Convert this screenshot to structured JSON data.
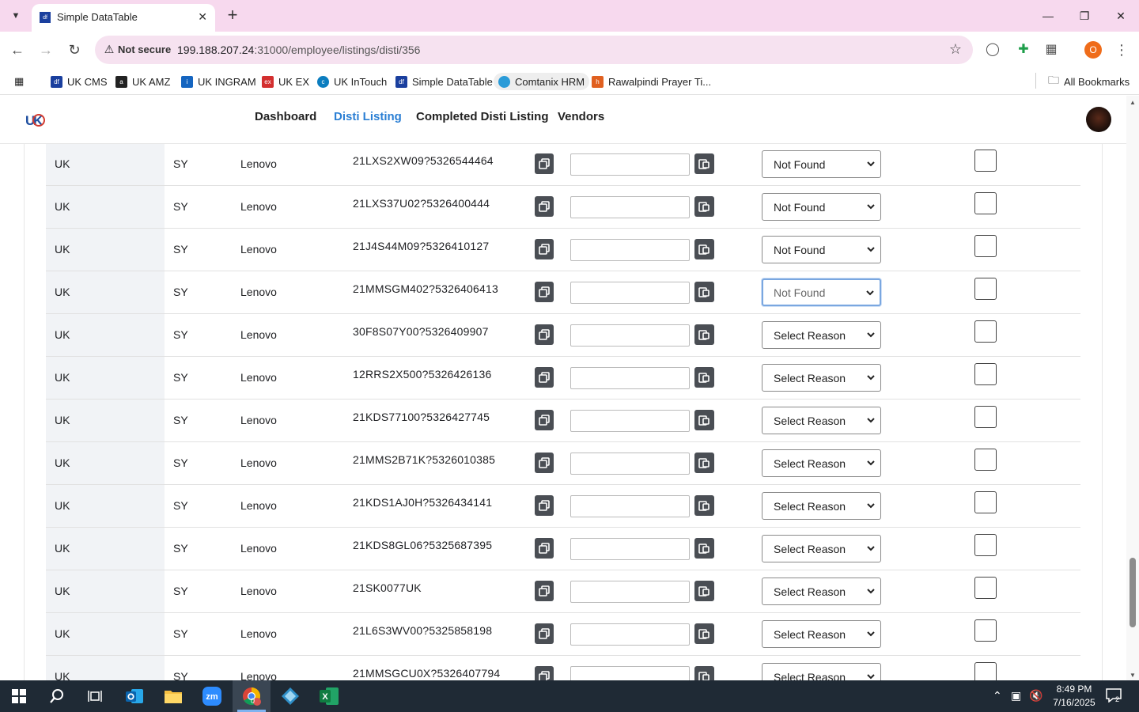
{
  "browser": {
    "tab_title": "Simple DataTable",
    "security_label": "Not secure",
    "url_host": "199.188.207.24",
    "url_rest": ":31000/employee/listings/disti/356",
    "profile_initial": "O",
    "bookmarks": [
      {
        "label": "UK CMS",
        "icon": "df-favicon",
        "color": "#1a3f9e"
      },
      {
        "label": "UK AMZ",
        "icon": "amazon-favicon",
        "color": "#222222"
      },
      {
        "label": "UK INGRAM",
        "icon": "ingram-favicon",
        "color": "#1565c0"
      },
      {
        "label": "UK EX",
        "icon": "ex-favicon",
        "color": "#d32f2f"
      },
      {
        "label": "UK InTouch",
        "icon": "intouch-favicon",
        "color": "#0b7dbf"
      },
      {
        "label": "Simple DataTable",
        "icon": "df-favicon",
        "color": "#1a3f9e"
      },
      {
        "label": "Comtanix HRM",
        "icon": "comtanix-favicon",
        "color": "#2a9bd8"
      },
      {
        "label": "Rawalpindi Prayer Ti...",
        "icon": "prayer-favicon",
        "color": "#e06020"
      }
    ],
    "all_bookmarks": "All Bookmarks"
  },
  "app": {
    "nav": [
      {
        "label": "Dashboard",
        "active": false
      },
      {
        "label": "Disti Listing",
        "active": true
      },
      {
        "label": "Completed Disti Listing",
        "active": false
      },
      {
        "label": "Vendors",
        "active": false
      }
    ]
  },
  "table": {
    "rows": [
      {
        "country": "UK",
        "source": "SY",
        "brand": "Lenovo",
        "sku": "21LXS2XW09?5326544464",
        "input": "",
        "reason": "Not Found",
        "focused": false,
        "checked": false
      },
      {
        "country": "UK",
        "source": "SY",
        "brand": "Lenovo",
        "sku": "21LXS37U02?5326400444",
        "input": "",
        "reason": "Not Found",
        "focused": false,
        "checked": false
      },
      {
        "country": "UK",
        "source": "SY",
        "brand": "Lenovo",
        "sku": "21J4S44M09?5326410127",
        "input": "",
        "reason": "Not Found",
        "focused": false,
        "checked": false
      },
      {
        "country": "UK",
        "source": "SY",
        "brand": "Lenovo",
        "sku": "21MMSGM402?5326406413",
        "input": "",
        "reason": "Not Found",
        "focused": true,
        "checked": false
      },
      {
        "country": "UK",
        "source": "SY",
        "brand": "Lenovo",
        "sku": "30F8S07Y00?5326409907",
        "input": "",
        "reason": "Select Reason",
        "focused": false,
        "checked": false
      },
      {
        "country": "UK",
        "source": "SY",
        "brand": "Lenovo",
        "sku": "12RRS2X500?5326426136",
        "input": "",
        "reason": "Select Reason",
        "focused": false,
        "checked": false
      },
      {
        "country": "UK",
        "source": "SY",
        "brand": "Lenovo",
        "sku": "21KDS77100?5326427745",
        "input": "",
        "reason": "Select Reason",
        "focused": false,
        "checked": false
      },
      {
        "country": "UK",
        "source": "SY",
        "brand": "Lenovo",
        "sku": "21MMS2B71K?5326010385",
        "input": "",
        "reason": "Select Reason",
        "focused": false,
        "checked": false
      },
      {
        "country": "UK",
        "source": "SY",
        "brand": "Lenovo",
        "sku": "21KDS1AJ0H?5326434141",
        "input": "",
        "reason": "Select Reason",
        "focused": false,
        "checked": false
      },
      {
        "country": "UK",
        "source": "SY",
        "brand": "Lenovo",
        "sku": "21KDS8GL06?5325687395",
        "input": "",
        "reason": "Select Reason",
        "focused": false,
        "checked": false
      },
      {
        "country": "UK",
        "source": "SY",
        "brand": "Lenovo",
        "sku": "21SK0077UK",
        "input": "",
        "reason": "Select Reason",
        "focused": false,
        "checked": false
      },
      {
        "country": "UK",
        "source": "SY",
        "brand": "Lenovo",
        "sku": "21L6S3WV00?5325858198",
        "input": "",
        "reason": "Select Reason",
        "focused": false,
        "checked": false
      },
      {
        "country": "UK",
        "source": "SY",
        "brand": "Lenovo",
        "sku": "21MMSGCU0X?5326407794",
        "input": "",
        "reason": "Select Reason",
        "focused": false,
        "checked": false
      }
    ]
  },
  "taskbar": {
    "time": "8:49 PM",
    "date": "7/16/2025",
    "notification_count": "2",
    "chrome_badge": "0"
  }
}
